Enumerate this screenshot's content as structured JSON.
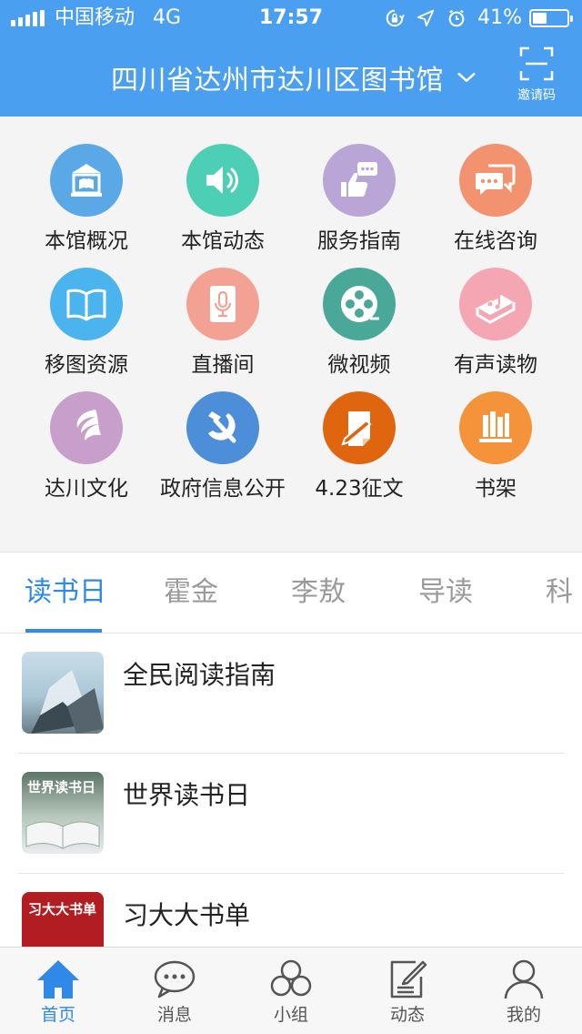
{
  "status_bar": {
    "carrier": "中国移动",
    "network": "4G",
    "time": "17:57",
    "battery_percent": "41%",
    "battery_level": 0.41,
    "icons": [
      "orientation-lock-icon",
      "location-icon",
      "alarm-icon"
    ]
  },
  "header": {
    "title": "四川省达州市达川区图书馆",
    "invite_label": "邀请码",
    "background_color": "#4a9ff0"
  },
  "grid": {
    "items": [
      {
        "label": "本馆概况",
        "icon": "library-building-icon",
        "color": "#5aa9e6"
      },
      {
        "label": "本馆动态",
        "icon": "speaker-icon",
        "color": "#4ccfb4"
      },
      {
        "label": "服务指南",
        "icon": "thumbs-up-chat-icon",
        "color": "#b9a6d6"
      },
      {
        "label": "在线咨询",
        "icon": "chat-bubbles-icon",
        "color": "#f2926f"
      },
      {
        "label": "移图资源",
        "icon": "open-book-icon",
        "color": "#4bb3ee"
      },
      {
        "label": "直播间",
        "icon": "microphone-icon",
        "color": "#f2a193"
      },
      {
        "label": "微视频",
        "icon": "film-reel-icon",
        "color": "#4aa898"
      },
      {
        "label": "有声读物",
        "icon": "music-book-icon",
        "color": "#f5a6b3"
      },
      {
        "label": "达川文化",
        "icon": "flame-logo-icon",
        "color": "#c79fca"
      },
      {
        "label": "政府信息公开",
        "icon": "hammer-sickle-icon",
        "color": "#4d8ed8"
      },
      {
        "label": "4.23征文",
        "icon": "pen-paper-icon",
        "color": "#e0650f"
      },
      {
        "label": "书架",
        "icon": "bookshelf-icon",
        "color": "#f5933a"
      }
    ]
  },
  "tabs": [
    {
      "label": "读书日",
      "active": true
    },
    {
      "label": "霍金",
      "active": false
    },
    {
      "label": "李敖",
      "active": false
    },
    {
      "label": "导读",
      "active": false
    },
    {
      "label": "科普",
      "active": false
    }
  ],
  "list": [
    {
      "title": "全民阅读指南"
    },
    {
      "title": "世界读书日",
      "thumb_text": "世界读书日"
    },
    {
      "title": "习大大书单",
      "thumb_text": "习大大书单"
    }
  ],
  "bottom_nav": [
    {
      "label": "首页",
      "icon": "home-icon",
      "active": true
    },
    {
      "label": "消息",
      "icon": "message-icon",
      "active": false
    },
    {
      "label": "小组",
      "icon": "group-icon",
      "active": false
    },
    {
      "label": "动态",
      "icon": "compose-icon",
      "active": false
    },
    {
      "label": "我的",
      "icon": "profile-icon",
      "active": false
    }
  ],
  "accent_color": "#2e8ae6"
}
